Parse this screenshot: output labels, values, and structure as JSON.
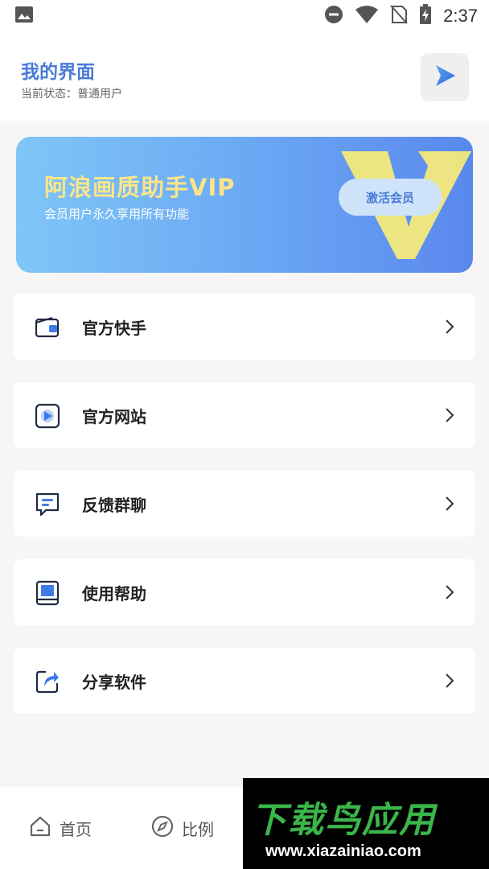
{
  "status_bar": {
    "time": "2:37",
    "icons": [
      "image-icon",
      "dnd-icon",
      "wifi-icon",
      "no-sim-icon",
      "battery-charging-icon"
    ]
  },
  "header": {
    "title": "我的界面",
    "subtitle": "当前状态：普通用户",
    "action_icon": "play-icon"
  },
  "vip_banner": {
    "title": "阿浪画质助手VIP",
    "description": "会员用户永久享用所有功能",
    "badge_letter": "V",
    "button_label": "激活会员",
    "colors": {
      "gradient_start": "#7fc6f7",
      "gradient_end": "#5a88ee",
      "title": "#fbe58a"
    }
  },
  "menu": {
    "items": [
      {
        "label": "官方快手",
        "icon": "wallet-icon"
      },
      {
        "label": "官方网站",
        "icon": "video-icon"
      },
      {
        "label": "反馈群聊",
        "icon": "chat-icon"
      },
      {
        "label": "使用帮助",
        "icon": "book-icon"
      },
      {
        "label": "分享软件",
        "icon": "share-icon"
      }
    ]
  },
  "bottom_nav": {
    "items": [
      {
        "label": "首页",
        "icon": "home-icon"
      },
      {
        "label": "比例",
        "icon": "compass-icon"
      }
    ]
  },
  "watermark": {
    "logo": "下载鸟应用",
    "url": "www.xiazainiao.com"
  },
  "colors": {
    "accent": "#4a7bd8",
    "icon_blue": "#3f7be6",
    "icon_dark": "#1f2a44"
  }
}
